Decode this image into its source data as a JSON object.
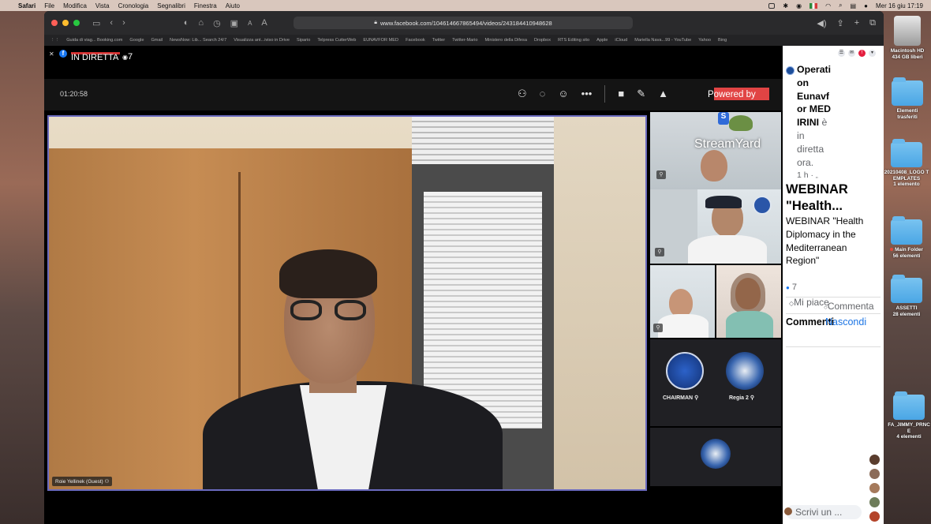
{
  "menubar": {
    "app": "Safari",
    "menus": [
      "File",
      "Modifica",
      "Vista",
      "Cronologia",
      "Segnalibri",
      "Finestra",
      "Aiuto"
    ],
    "clock": "Mer 16 giu  17:19"
  },
  "browser": {
    "url": "www.facebook.com/104614667865494/videos/243184410948628",
    "bookmarks": [
      "Guida di viag... Booking.com",
      "Google",
      "Gmail",
      "NewsNow: Lib... Search 24/7",
      "Visualizza ant...iviso in Drive",
      "Sipario",
      "Telpress CutterWeb",
      "EUNAVFOR MED",
      "Facebook",
      "Twitter",
      "Twitter-Mario",
      "Ministero della Difesa",
      "Dropbox",
      "RTS Editing sito",
      "Apple",
      "iCloud",
      "Mariella Nava...99 - YouTube",
      "Yahoo",
      "Bing"
    ]
  },
  "video": {
    "live_label": "IN DIRETTA",
    "viewer_count": "7",
    "timer": "01:20:58",
    "powered_by": "Powered by",
    "main_speaker": "Roie Yellinek (Guest)",
    "streamyard_label": "StreamYard",
    "participants": [
      {
        "label": "CHAIRMAN"
      },
      {
        "label": "Regia 2"
      }
    ]
  },
  "post": {
    "page_name_line1": "Operati",
    "page_name_line2": "on",
    "page_name_line3": "Eunavf",
    "page_name_line4": "or MED",
    "page_name_line5": "IRINI",
    "status_line1": "è",
    "status_line2": "in",
    "status_line3": "diretta",
    "status_line4": "ora.",
    "time": "1 h · ",
    "title": "WEBINAR \"Health...",
    "body": "WEBINAR \"Health Diplomacy in the Mediterranean Region\"",
    "likes_count": "7",
    "like_label": "Mi piace",
    "comment_label": "Commenta",
    "comments_header": "Commenti",
    "hide_label": "Nascondi",
    "write_placeholder": "Scrivi un ..."
  },
  "desktop": {
    "icons": [
      {
        "name": "Macintosh HD",
        "sub": "434 GB liberi"
      },
      {
        "name": "Elementi trasferiti",
        "sub": ""
      },
      {
        "name": "20210408_LOGO TEMPLATES",
        "sub": "1 elemento"
      },
      {
        "name": "Main Folder",
        "sub": "56 elementi"
      },
      {
        "name": "ASSETTI",
        "sub": "28 elementi"
      },
      {
        "name": "FA_JIMMY_PRNCE",
        "sub": "4 elementi"
      }
    ]
  },
  "colors": {
    "facebook_blue": "#1877f2",
    "live_red": "#d23030",
    "active_speaker_border": "#6b6bbf",
    "link_blue": "#1b74e4"
  }
}
